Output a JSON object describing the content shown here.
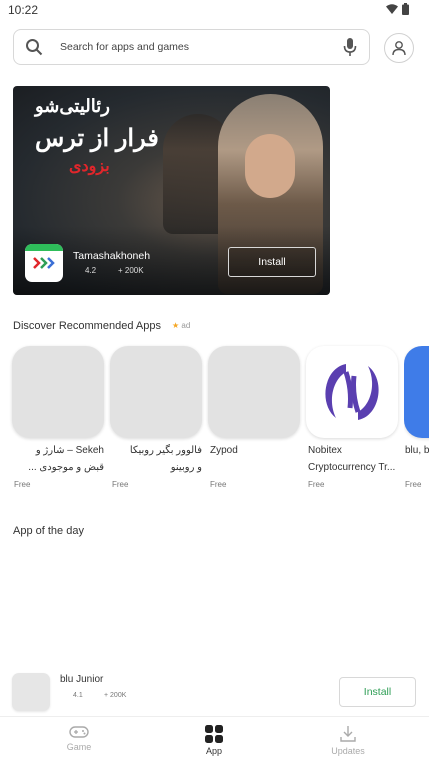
{
  "status_bar": {
    "time": "10:22",
    "icons": [
      "wifi-icon",
      "battery-icon"
    ]
  },
  "search": {
    "placeholder": "Search for apps and games"
  },
  "banner": {
    "title_line1": "رئالیتی‌شو",
    "title_line2": "فرار از ترس",
    "title_line3": "بزودی",
    "app_name": "Tamashakhoneh",
    "rating": "4.2",
    "downloads": "+ 200K",
    "install_label": "Install"
  },
  "recommended": {
    "title": "Discover Recommended Apps",
    "ad_label": "ad",
    "apps": [
      {
        "name_line1": "Sekeh – شارژ و",
        "name_line2": "قبض و موجودی ...",
        "price": "Free"
      },
      {
        "name_line1": "فالوور بگیر روبیکا",
        "name_line2": "و روبینو",
        "price": "Free"
      },
      {
        "name_line1": "Zypod",
        "name_line2": "",
        "price": "Free"
      },
      {
        "name_line1": "Nobitex",
        "name_line2": "Cryptocurrency Tr...",
        "price": "Free"
      },
      {
        "name_line1": "blu, b",
        "name_line2": "",
        "price": "Free"
      }
    ]
  },
  "app_of_the_day": {
    "title": "App of the day"
  },
  "featured_row": {
    "name": "blu Junior",
    "rating": "4.1",
    "downloads": "+ 200K",
    "install_label": "Install"
  },
  "bottom_nav": {
    "items": [
      {
        "label": "Game"
      },
      {
        "label": "App"
      },
      {
        "label": "Updates"
      }
    ]
  },
  "colors": {
    "accent_green": "#2e9e55",
    "ad_star": "#f5a623",
    "banner_red": "#e0262b",
    "nobitex_purple": "#5a3fb0"
  }
}
